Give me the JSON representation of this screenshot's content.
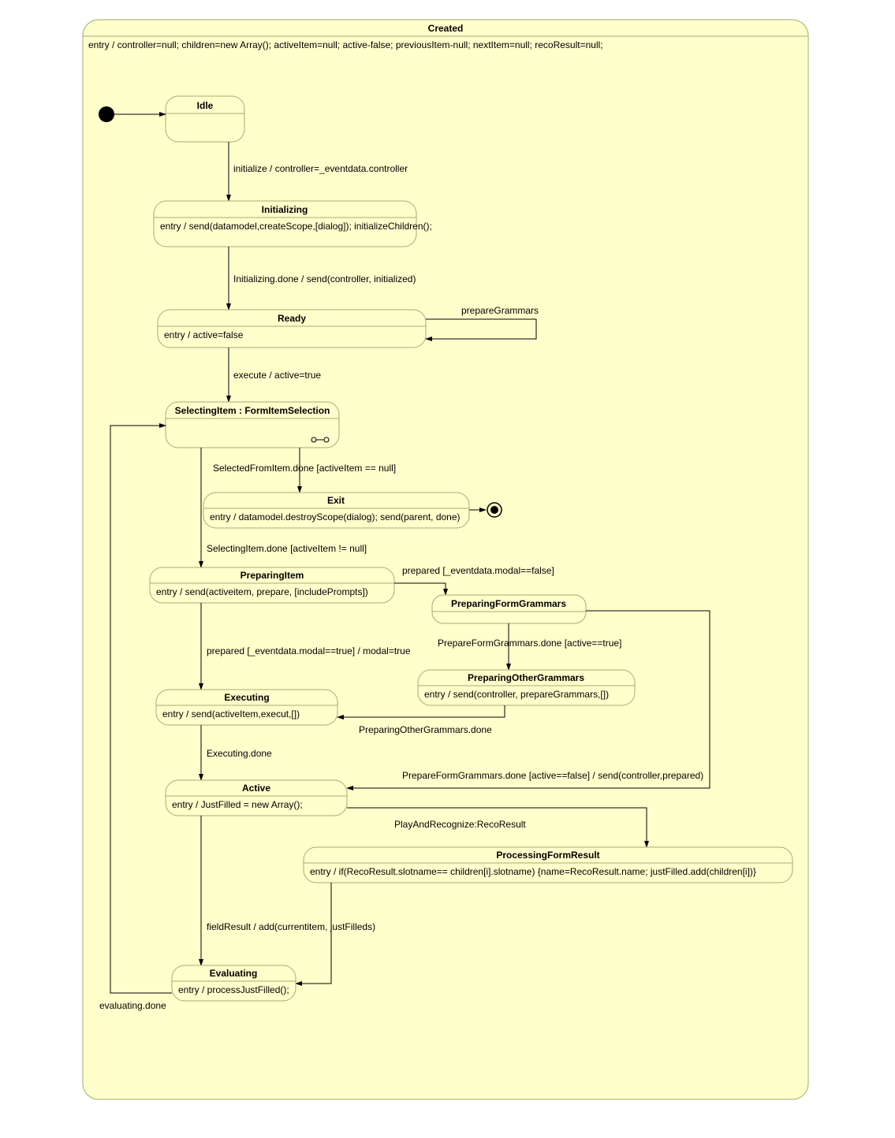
{
  "outer": {
    "title": "Created",
    "entry": "entry / controller=null; children=new Array(); activeItem=null; active-false; previousItem-null; nextItem=null; recoResult=null;"
  },
  "states": {
    "idle": {
      "title": "Idle"
    },
    "initializing": {
      "title": "Initializing",
      "entry": "entry / send(datamodel,createScope,[dialog]); initializeChildren();"
    },
    "ready": {
      "title": "Ready",
      "entry": "entry / active=false"
    },
    "selectingItem": {
      "title": "SelectingItem  : FormItemSelection"
    },
    "exit": {
      "title": "Exit",
      "entry": "entry / datamodel.destroyScope(dialog); send(parent, done)"
    },
    "preparingItem": {
      "title": "PreparingItem",
      "entry": "entry / send(activeitem, prepare, [includePrompts])"
    },
    "preparingFormGrammars": {
      "title": "PreparingFormGrammars"
    },
    "preparingOtherGrammars": {
      "title": "PreparingOtherGrammars",
      "entry": "entry / send(controller, prepareGrammars,[])"
    },
    "executing": {
      "title": "Executing",
      "entry": "entry / send(activeItem,execut,[])"
    },
    "active": {
      "title": "Active",
      "entry": "entry / JustFilled = new Array();"
    },
    "processingFormResult": {
      "title": "ProcessingFormResult",
      "entry": "entry / if(RecoResult.slotname== children[i].slotname) {name=RecoResult.name; justFilled.add(children[i])}"
    },
    "evaluating": {
      "title": "Evaluating",
      "entry": "entry / processJustFilled();"
    }
  },
  "transitions": {
    "t_initialize": "initialize / controller=_eventdata.controller",
    "t_initDone": "Initializing.done / send(controller, initialized)",
    "t_prepareGrammars": "prepareGrammars",
    "t_execute": "execute / active=true",
    "t_selectedNull": "SelectedFromItem.done [activeItem == null]",
    "t_selectingDone": "SelectingItem.done [activeItem != null]",
    "t_preparedModalFalse": "prepared [_eventdata.modal==false]",
    "t_pfgDoneTrue": "PrepareFormGrammars.done [active==true]",
    "t_preparedModalTrue": "prepared [_eventdata.modal==true] / modal=true",
    "t_pogDone": "PreparingOtherGrammars.done",
    "t_executingDone": "Executing.done",
    "t_pfgDoneFalse": "PrepareFormGrammars.done [active==false] / send(controller,prepared)",
    "t_playReco": "PlayAndRecognize:RecoResult",
    "t_fieldResult": "fieldResult / add(currentitem, justFilleds)",
    "t_evaluatingDone": "evaluating.done"
  }
}
